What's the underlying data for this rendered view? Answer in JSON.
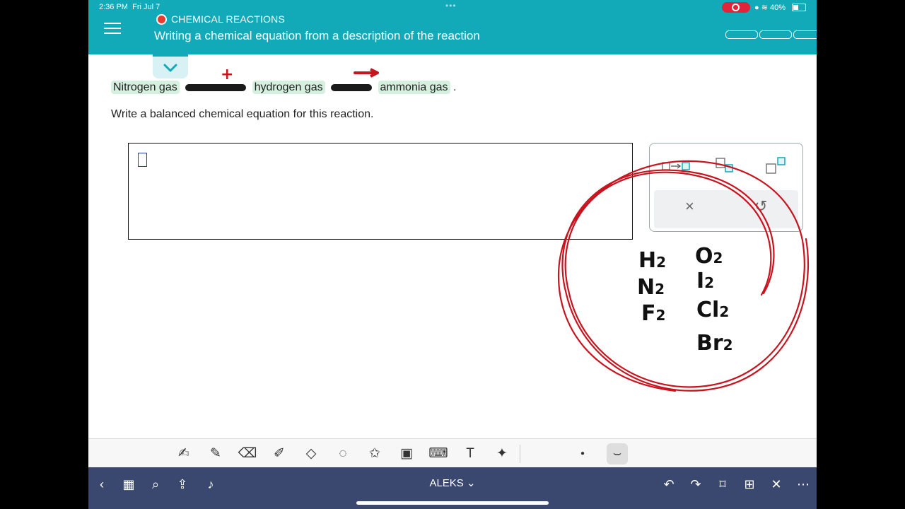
{
  "status": {
    "time": "2:36 PM",
    "date": "Fri Jul 7",
    "battery": "40%",
    "dots": "•••"
  },
  "header": {
    "topic": "CHEMICAL REACTIONS",
    "title": "Writing a chemical equation from a description of the reaction"
  },
  "question": {
    "reactant1": "Nitrogen gas",
    "reactant2": "hydrogen gas",
    "product": "ammonia gas",
    "end": ".",
    "instruction": "Write a balanced chemical equation for this reaction."
  },
  "palette": {
    "clear": "×",
    "undo": "↺"
  },
  "annotations": {
    "plus": "+",
    "formulas_left": [
      "H",
      "N",
      "F"
    ],
    "formulas_right": [
      "O",
      "I",
      "Cl",
      "Br"
    ],
    "subscript": "2"
  },
  "navbar": {
    "title": "ALEKS ⌄"
  },
  "colors": {
    "accent": "#12aab9",
    "ink_red": "#c8141e",
    "nav_bg": "#3a4870"
  }
}
